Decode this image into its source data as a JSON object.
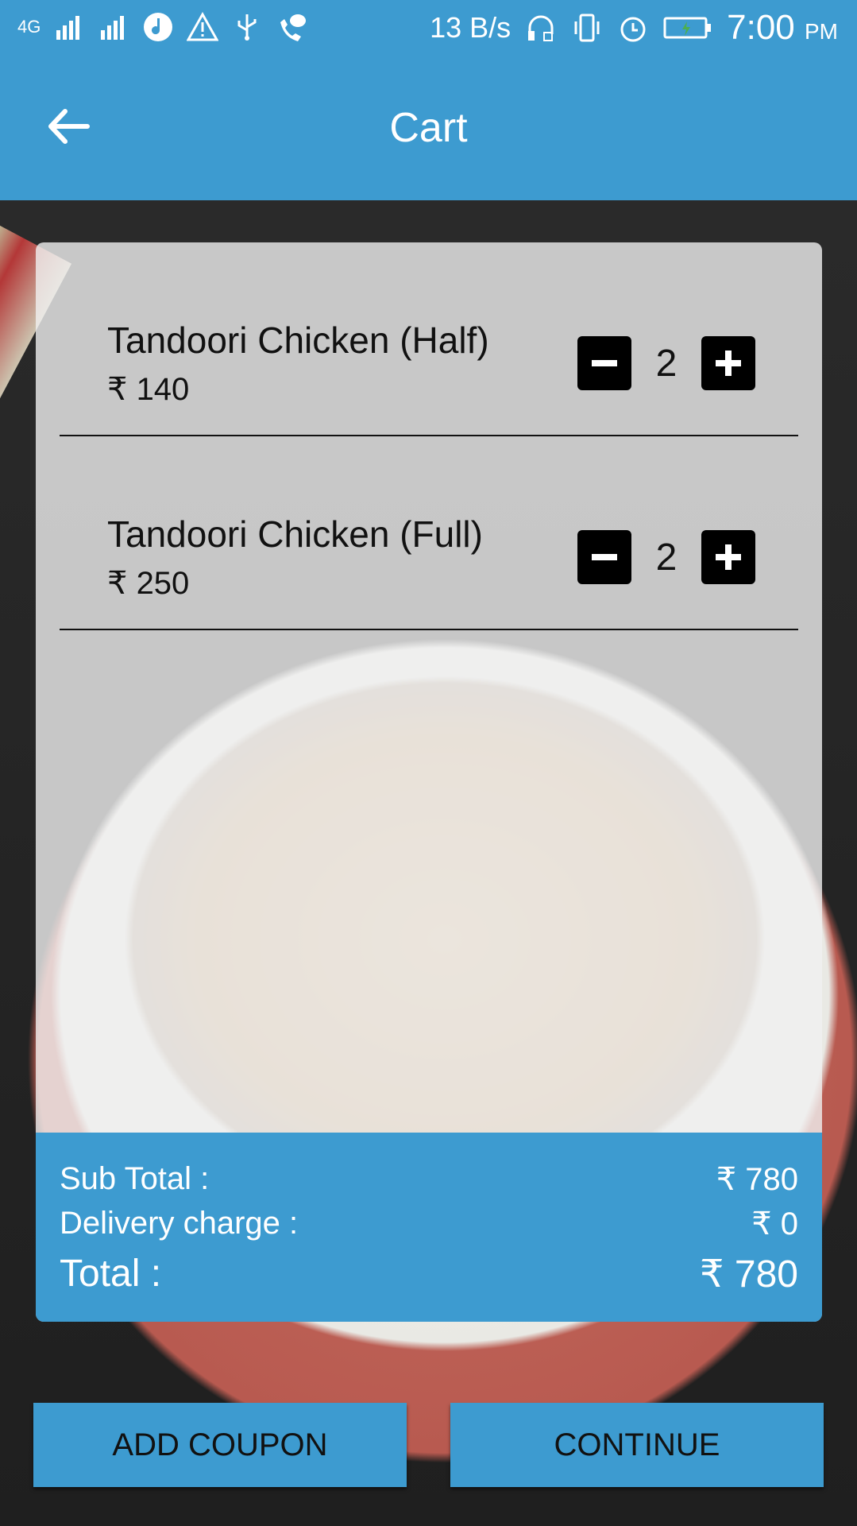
{
  "status_bar": {
    "network": "4G",
    "speed": "13 B/s",
    "time": "7:00",
    "ampm": "PM",
    "icons": [
      "signal-icon",
      "signal-icon",
      "music-icon",
      "warning-icon",
      "usb-icon",
      "missed-call-icon",
      "headset-icon",
      "vibrate-icon",
      "alarm-icon",
      "battery-icon"
    ]
  },
  "app_bar": {
    "title": "Cart",
    "back_icon": "arrow-left-icon"
  },
  "cart": {
    "items": [
      {
        "name": "Tandoori Chicken (Half)",
        "price": "₹ 140",
        "qty": "2"
      },
      {
        "name": "Tandoori Chicken (Full)",
        "price": "₹ 250",
        "qty": "2"
      }
    ]
  },
  "summary": {
    "subtotal_label": "Sub Total :",
    "subtotal_value": "₹ 780",
    "delivery_label": "Delivery charge :",
    "delivery_value": "₹ 0",
    "total_label": "Total :",
    "total_value": "₹ 780"
  },
  "buttons": {
    "add_coupon": "ADD COUPON",
    "continue": "CONTINUE"
  },
  "colors": {
    "primary": "#3d9bd0"
  }
}
